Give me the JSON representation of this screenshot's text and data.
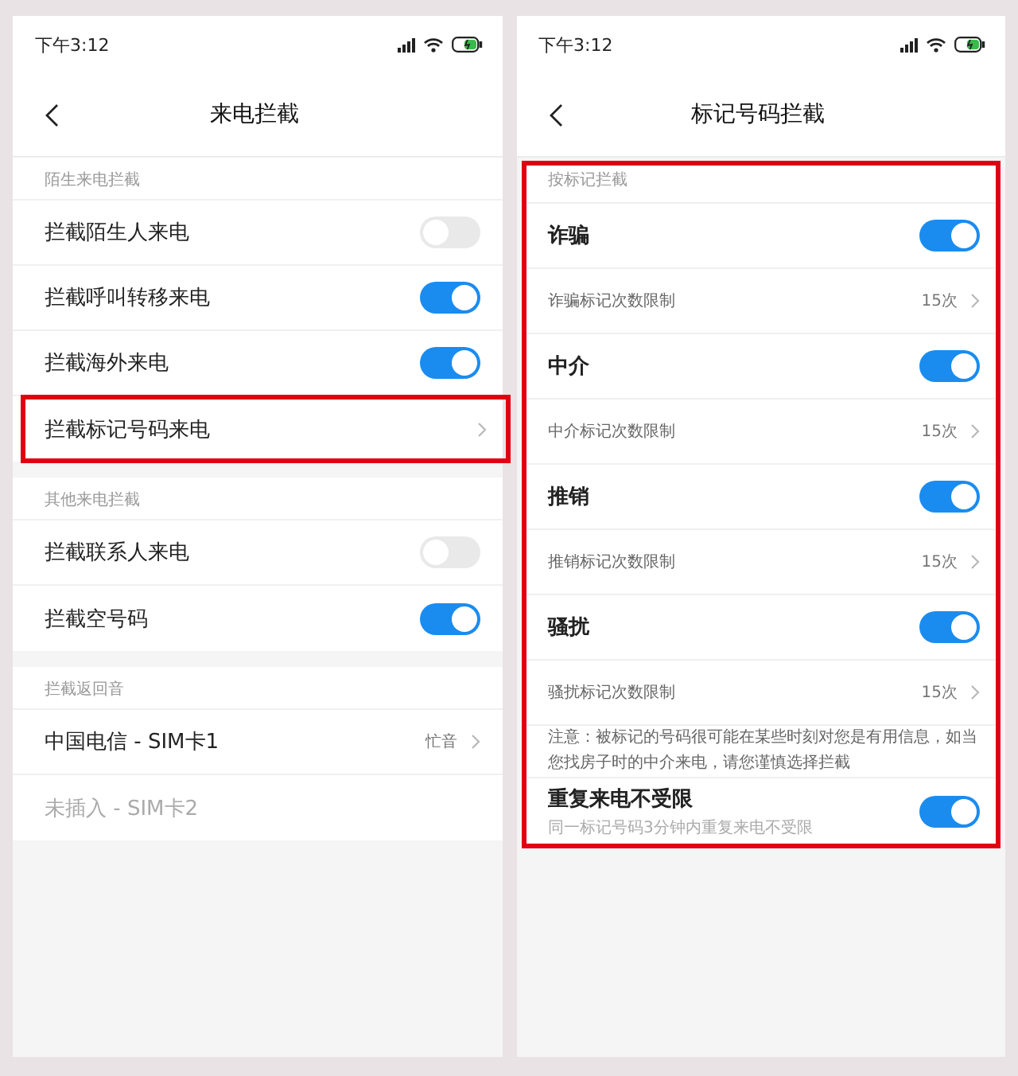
{
  "screens": [
    {
      "status_time": "下午3:12",
      "title": "来电拦截",
      "sections": [
        {
          "header": "陌生来电拦截",
          "highlighted": false,
          "rows": [
            {
              "kind": "toggle",
              "label": "拦截陌生人来电",
              "on": false,
              "highlighted": false
            },
            {
              "kind": "toggle",
              "label": "拦截呼叫转移来电",
              "on": true,
              "highlighted": false
            },
            {
              "kind": "toggle",
              "label": "拦截海外来电",
              "on": true,
              "highlighted": false
            },
            {
              "kind": "link",
              "label": "拦截标记号码来电",
              "highlighted": true
            }
          ]
        },
        {
          "header": "其他来电拦截",
          "highlighted": false,
          "rows": [
            {
              "kind": "toggle",
              "label": "拦截联系人来电",
              "on": false,
              "highlighted": false
            },
            {
              "kind": "toggle",
              "label": "拦截空号码",
              "on": true,
              "highlighted": false
            }
          ]
        },
        {
          "header": "拦截返回音",
          "highlighted": false,
          "rows": [
            {
              "kind": "link",
              "label": "中国电信 - SIM卡1",
              "value": "忙音",
              "highlighted": false
            },
            {
              "kind": "disabled",
              "label": "未插入 - SIM卡2",
              "highlighted": false
            }
          ]
        }
      ]
    },
    {
      "status_time": "下午3:12",
      "title": "标记号码拦截",
      "sections": [
        {
          "header": "按标记拦截",
          "highlighted": true,
          "rows": [
            {
              "kind": "toggle",
              "label": "诈骗",
              "on": true,
              "highlighted": false
            },
            {
              "kind": "sublink",
              "label": "诈骗标记次数限制",
              "value": "15次",
              "highlighted": false
            },
            {
              "kind": "toggle",
              "label": "中介",
              "on": true,
              "highlighted": false
            },
            {
              "kind": "sublink",
              "label": "中介标记次数限制",
              "value": "15次",
              "highlighted": false
            },
            {
              "kind": "toggle",
              "label": "推销",
              "on": true,
              "highlighted": false
            },
            {
              "kind": "sublink",
              "label": "推销标记次数限制",
              "value": "15次",
              "highlighted": false
            },
            {
              "kind": "toggle",
              "label": "骚扰",
              "on": true,
              "highlighted": false
            },
            {
              "kind": "sublink",
              "label": "骚扰标记次数限制",
              "value": "15次",
              "highlighted": false
            },
            {
              "kind": "note",
              "label": "注意：被标记的号码很可能在某些时刻对您是有用信息，如当您找房子时的中介来电，请您谨慎选择拦截",
              "highlighted": false
            },
            {
              "kind": "toggle",
              "label": "重复来电不受限",
              "subtitle": "同一标记号码3分钟内重复来电不受限",
              "on": true,
              "highlighted": false
            }
          ]
        }
      ]
    }
  ]
}
